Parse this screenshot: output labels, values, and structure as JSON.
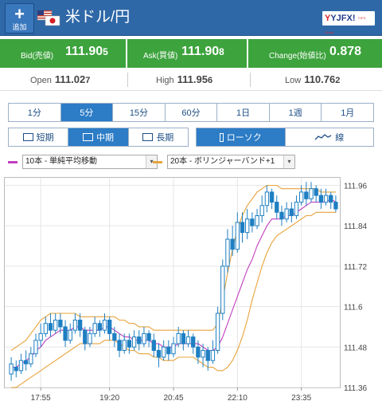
{
  "header": {
    "add_label": "追加",
    "title": "米ドル/円",
    "logo_text": "YJFX!",
    "logo_tag": "YJFX Group"
  },
  "quotes": {
    "bid_label": "Bid(売値)",
    "bid_main": "111.90",
    "bid_last": "5",
    "ask_label": "Ask(買値)",
    "ask_main": "111.90",
    "ask_last": "8",
    "change_label": "Change(始値比)",
    "change_value": "0.878"
  },
  "stats": {
    "open_label": "Open",
    "open_main": "111.02",
    "open_last": "7",
    "high_label": "High",
    "high_main": "111.95",
    "high_last": "6",
    "low_label": "Low",
    "low_main": "110.76",
    "low_last": "2"
  },
  "periods": [
    "1分",
    "5分",
    "15分",
    "60分",
    "1日",
    "1週",
    "1月"
  ],
  "active_period": "5分",
  "ranges": [
    "短期",
    "中期",
    "長期"
  ],
  "active_range": "中期",
  "chart_types": [
    "ローソク",
    "線"
  ],
  "active_chart_type": "ローソク",
  "indicators": [
    {
      "label": "10本 - 単純平均移動",
      "color": "#c23fc0"
    },
    {
      "label": "20本 - ボリンジャーバンド+1",
      "color": "#e8a33b"
    }
  ],
  "colors": {
    "header_bg": "#2f68a7",
    "quote_bg": "#3da33d",
    "candle": "#1e7fc2",
    "accent_blue": "#2c7cc6"
  },
  "chart_data": {
    "type": "candlestick",
    "x_ticks": [
      "17:55",
      "19:20",
      "20:45",
      "22:10",
      "23:35"
    ],
    "y_ticks": [
      111.36,
      111.48,
      111.6,
      111.72,
      111.84,
      111.96
    ],
    "ylim": [
      111.36,
      111.98
    ],
    "candles": [
      [
        111.4,
        111.43,
        111.38,
        111.45
      ],
      [
        111.42,
        111.41,
        111.39,
        111.44
      ],
      [
        111.41,
        111.44,
        111.4,
        111.46
      ],
      [
        111.44,
        111.43,
        111.41,
        111.47
      ],
      [
        111.43,
        111.46,
        111.42,
        111.48
      ],
      [
        111.46,
        111.5,
        111.45,
        111.52
      ],
      [
        111.5,
        111.52,
        111.48,
        111.55
      ],
      [
        111.52,
        111.55,
        111.51,
        111.57
      ],
      [
        111.55,
        111.53,
        111.51,
        111.58
      ],
      [
        111.53,
        111.56,
        111.52,
        111.58
      ],
      [
        111.56,
        111.54,
        111.52,
        111.58
      ],
      [
        111.54,
        111.5,
        111.48,
        111.56
      ],
      [
        111.5,
        111.53,
        111.49,
        111.55
      ],
      [
        111.53,
        111.56,
        111.52,
        111.58
      ],
      [
        111.56,
        111.53,
        111.51,
        111.58
      ],
      [
        111.53,
        111.49,
        111.47,
        111.54
      ],
      [
        111.49,
        111.52,
        111.48,
        111.54
      ],
      [
        111.52,
        111.55,
        111.51,
        111.57
      ],
      [
        111.55,
        111.53,
        111.51,
        111.56
      ],
      [
        111.53,
        111.56,
        111.52,
        111.58
      ],
      [
        111.56,
        111.52,
        111.5,
        111.57
      ],
      [
        111.52,
        111.5,
        111.48,
        111.54
      ],
      [
        111.5,
        111.47,
        111.45,
        111.52
      ],
      [
        111.47,
        111.5,
        111.46,
        111.52
      ],
      [
        111.5,
        111.48,
        111.46,
        111.52
      ],
      [
        111.48,
        111.51,
        111.47,
        111.53
      ],
      [
        111.51,
        111.49,
        111.47,
        111.53
      ],
      [
        111.49,
        111.52,
        111.48,
        111.54
      ],
      [
        111.52,
        111.5,
        111.48,
        111.53
      ],
      [
        111.5,
        111.47,
        111.45,
        111.52
      ],
      [
        111.47,
        111.45,
        111.42,
        111.49
      ],
      [
        111.45,
        111.48,
        111.44,
        111.5
      ],
      [
        111.48,
        111.46,
        111.44,
        111.5
      ],
      [
        111.46,
        111.49,
        111.45,
        111.51
      ],
      [
        111.49,
        111.52,
        111.48,
        111.54
      ],
      [
        111.52,
        111.49,
        111.47,
        111.53
      ],
      [
        111.49,
        111.51,
        111.48,
        111.53
      ],
      [
        111.51,
        111.48,
        111.46,
        111.52
      ],
      [
        111.48,
        111.45,
        111.43,
        111.5
      ],
      [
        111.45,
        111.47,
        111.42,
        111.49
      ],
      [
        111.47,
        111.44,
        111.41,
        111.48
      ],
      [
        111.44,
        111.47,
        111.43,
        111.5
      ],
      [
        111.47,
        111.58,
        111.46,
        111.6
      ],
      [
        111.58,
        111.72,
        111.56,
        111.74
      ],
      [
        111.72,
        111.8,
        111.7,
        111.83
      ],
      [
        111.8,
        111.77,
        111.75,
        111.84
      ],
      [
        111.77,
        111.85,
        111.76,
        111.88
      ],
      [
        111.85,
        111.82,
        111.79,
        111.88
      ],
      [
        111.82,
        111.86,
        111.8,
        111.89
      ],
      [
        111.86,
        111.84,
        111.82,
        111.88
      ],
      [
        111.84,
        111.87,
        111.83,
        111.89
      ],
      [
        111.87,
        111.9,
        111.85,
        111.93
      ],
      [
        111.9,
        111.94,
        111.88,
        111.96
      ],
      [
        111.94,
        111.91,
        111.89,
        111.95
      ],
      [
        111.91,
        111.88,
        111.86,
        111.93
      ],
      [
        111.88,
        111.86,
        111.84,
        111.9
      ],
      [
        111.86,
        111.89,
        111.85,
        111.91
      ],
      [
        111.89,
        111.87,
        111.85,
        111.91
      ],
      [
        111.87,
        111.91,
        111.86,
        111.93
      ],
      [
        111.91,
        111.94,
        111.9,
        111.96
      ],
      [
        111.94,
        111.92,
        111.9,
        111.97
      ],
      [
        111.92,
        111.95,
        111.91,
        111.97
      ],
      [
        111.95,
        111.93,
        111.91,
        111.96
      ],
      [
        111.93,
        111.91,
        111.89,
        111.95
      ],
      [
        111.91,
        111.93,
        111.9,
        111.95
      ],
      [
        111.93,
        111.91,
        111.89,
        111.94
      ],
      [
        111.91,
        111.89,
        111.88,
        111.93
      ]
    ],
    "ma_line": [
      111.42,
      111.42,
      111.43,
      111.44,
      111.45,
      111.47,
      111.48,
      111.5,
      111.51,
      111.52,
      111.53,
      111.53,
      111.53,
      111.54,
      111.54,
      111.53,
      111.53,
      111.53,
      111.53,
      111.54,
      111.54,
      111.53,
      111.52,
      111.51,
      111.51,
      111.5,
      111.5,
      111.5,
      111.5,
      111.49,
      111.49,
      111.48,
      111.48,
      111.48,
      111.49,
      111.49,
      111.49,
      111.49,
      111.49,
      111.48,
      111.47,
      111.47,
      111.48,
      111.51,
      111.55,
      111.59,
      111.63,
      111.67,
      111.71,
      111.74,
      111.78,
      111.81,
      111.84,
      111.86,
      111.86,
      111.86,
      111.87,
      111.87,
      111.88,
      111.89,
      111.9,
      111.91,
      111.91,
      111.91,
      111.91,
      111.92,
      111.91
    ],
    "bb_upper": [
      111.47,
      111.48,
      111.49,
      111.5,
      111.52,
      111.54,
      111.56,
      111.57,
      111.58,
      111.58,
      111.58,
      111.58,
      111.58,
      111.58,
      111.57,
      111.57,
      111.57,
      111.57,
      111.57,
      111.57,
      111.57,
      111.57,
      111.56,
      111.56,
      111.55,
      111.55,
      111.54,
      111.54,
      111.54,
      111.53,
      111.53,
      111.53,
      111.53,
      111.53,
      111.53,
      111.53,
      111.53,
      111.53,
      111.53,
      111.53,
      111.53,
      111.53,
      111.55,
      111.62,
      111.7,
      111.77,
      111.83,
      111.87,
      111.9,
      111.92,
      111.94,
      111.95,
      111.96,
      111.96,
      111.96,
      111.95,
      111.95,
      111.95,
      111.95,
      111.95,
      111.95,
      111.95,
      111.95,
      111.94,
      111.94,
      111.94,
      111.94
    ],
    "bb_lower": [
      111.36,
      111.36,
      111.37,
      111.38,
      111.39,
      111.4,
      111.41,
      111.42,
      111.43,
      111.44,
      111.45,
      111.46,
      111.47,
      111.48,
      111.49,
      111.49,
      111.49,
      111.49,
      111.49,
      111.5,
      111.5,
      111.5,
      111.49,
      111.48,
      111.47,
      111.47,
      111.46,
      111.46,
      111.46,
      111.45,
      111.45,
      111.44,
      111.44,
      111.44,
      111.45,
      111.45,
      111.45,
      111.45,
      111.44,
      111.43,
      111.42,
      111.42,
      111.41,
      111.41,
      111.42,
      111.44,
      111.47,
      111.51,
      111.56,
      111.62,
      111.67,
      111.72,
      111.76,
      111.79,
      111.81,
      111.82,
      111.83,
      111.84,
      111.85,
      111.86,
      111.87,
      111.87,
      111.88,
      111.88,
      111.88,
      111.88,
      111.88
    ]
  }
}
